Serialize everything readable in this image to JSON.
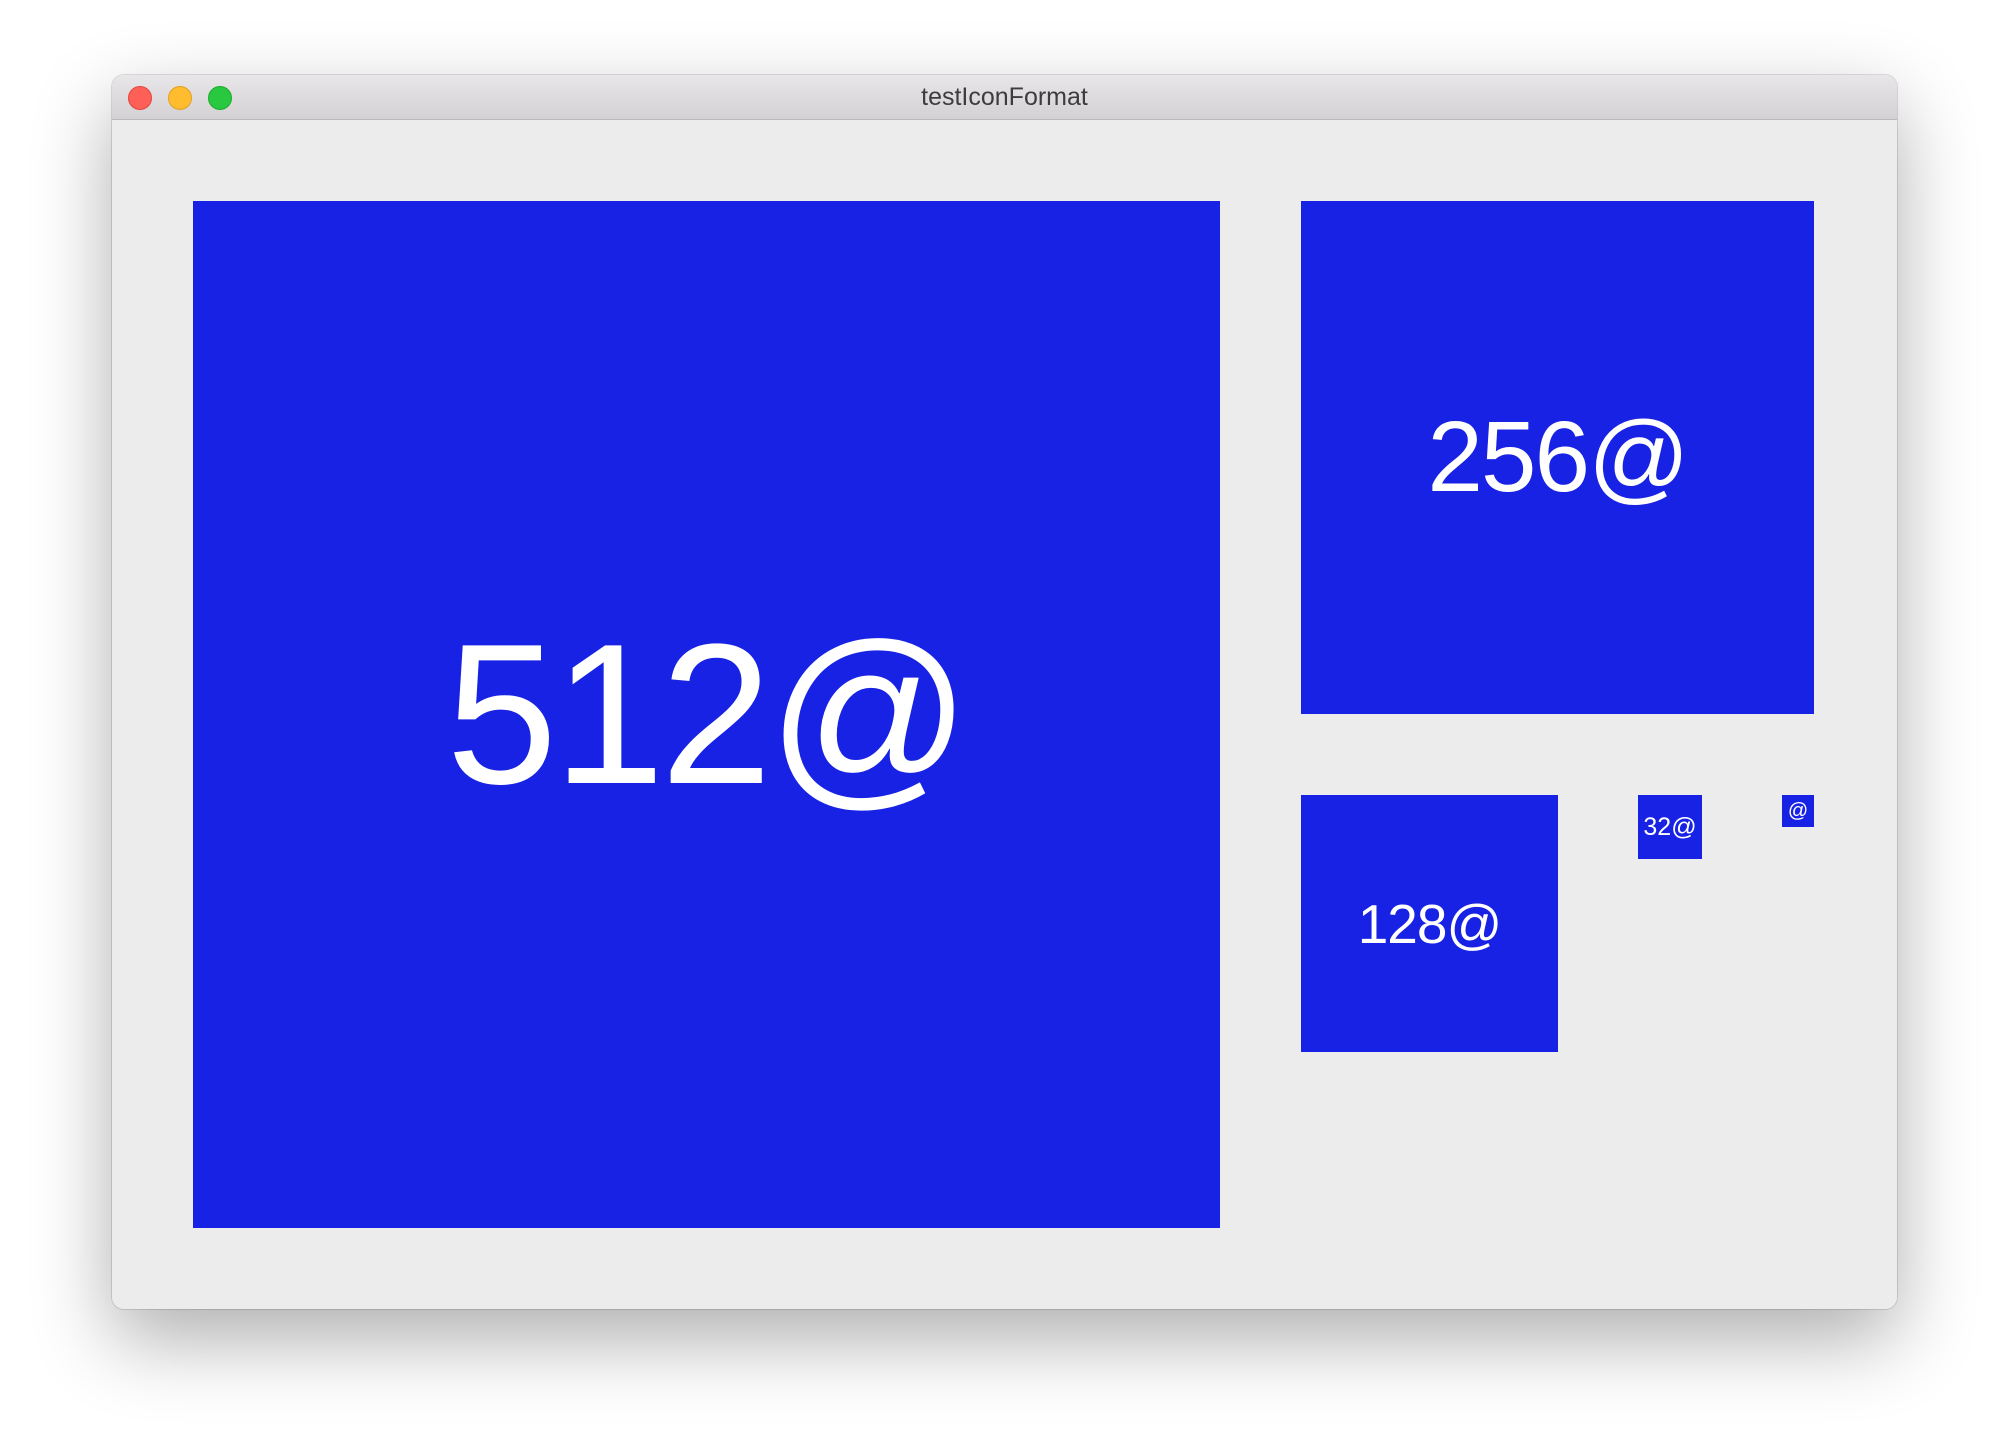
{
  "window": {
    "title": "testIconFormat"
  },
  "icons": {
    "icon_512": "512@",
    "icon_256": "256@",
    "icon_128": "128@",
    "icon_32": "32@",
    "icon_16": "@"
  },
  "colors": {
    "icon_background": "#1822e4",
    "icon_text": "#ffffff",
    "window_background": "#ececec",
    "close_button": "#fe5f57",
    "minimize_button": "#febc2e",
    "maximize_button": "#28c840"
  }
}
